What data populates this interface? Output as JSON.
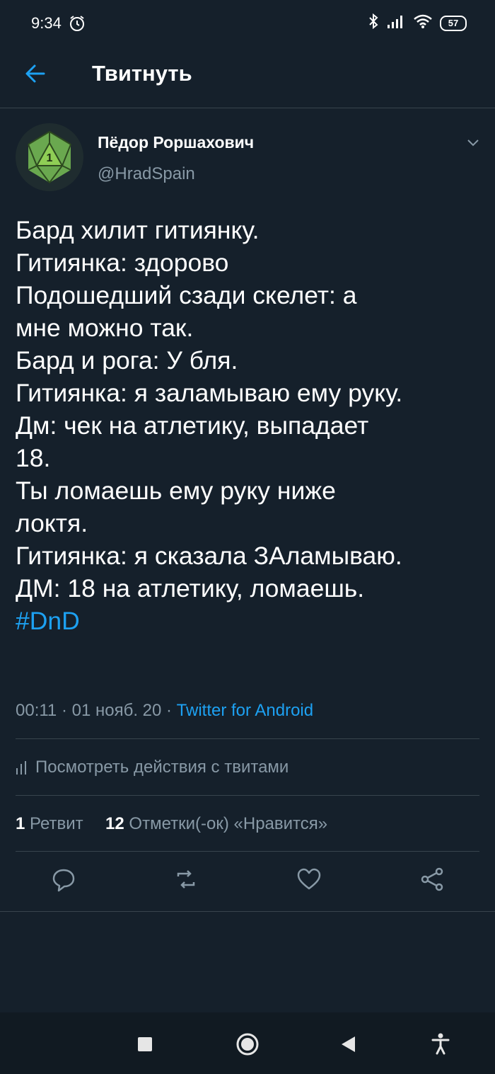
{
  "status_bar": {
    "time": "9:34",
    "battery": "57"
  },
  "header": {
    "title": "Твитнуть"
  },
  "author": {
    "name": "Пёдор Роршахович",
    "handle": "@HradSpain",
    "avatar_die_number": "1"
  },
  "tweet": {
    "lines": [
      "Бард хилит гитиянку.",
      "Гитиянка: здорово",
      "Подошедший сзади скелет: а",
      "мне можно так.",
      "Бард и рога: У бля.",
      "Гитиянка: я заламываю ему руку.",
      "Дм: чек на атлетику, выпадает",
      "18.",
      "Ты ломаешь ему руку ниже",
      "локтя.",
      "Гитиянка: я сказала ЗАламываю.",
      "ДМ: 18 на атлетику, ломаешь."
    ],
    "hashtag": "#DnD",
    "meta": "00:11 · 01 нояб. 20 · ",
    "source": "Twitter for Android"
  },
  "activity": {
    "label": "Посмотреть действия с твитами"
  },
  "stats": {
    "retweets_count": "1",
    "retweets_label": "Ретвит",
    "likes_count": "12",
    "likes_label": "Отметки(-ок) «Нравится»"
  },
  "colors": {
    "background": "#15202b",
    "accent": "#1da1f2",
    "muted": "#8899a6",
    "divider": "#38444d"
  },
  "icons": {
    "back": "arrow-left-icon",
    "more": "chevron-down-icon",
    "reply": "speech-bubble-icon",
    "retweet": "retweet-icon",
    "like": "heart-icon",
    "share": "share-icon",
    "activity": "bar-chart-icon"
  }
}
